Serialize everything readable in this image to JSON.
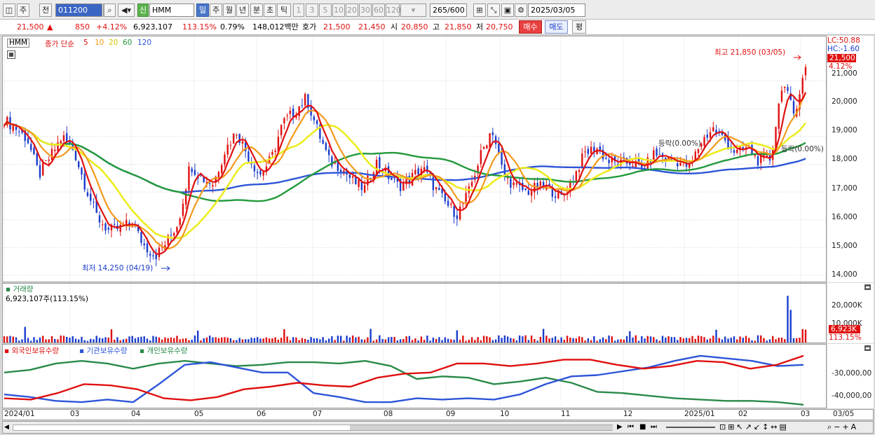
{
  "toolbar": {
    "period_week": "주",
    "period_prev": "전",
    "code": "011200",
    "name_badge": "신",
    "name": "HMM",
    "tabs": [
      "일",
      "주",
      "월",
      "년",
      "분",
      "초",
      "틱"
    ],
    "periods": [
      "1",
      "3",
      "5",
      "10",
      "20",
      "30",
      "60",
      "120"
    ],
    "count": "265",
    "count_total": "/600",
    "date": "2025/03/05"
  },
  "quote": {
    "price": "21,500",
    "change_arrow": "▲",
    "change": "850",
    "change_pct": "+4.12%",
    "volume": "6,923,107",
    "volume_ratio": "113.15%",
    "turnover": "0.79%",
    "amount": "148,012백만",
    "ask_label": "호가",
    "ask": "21,500",
    "bid": "21,450",
    "open_label": "시",
    "open": "20,850",
    "high_label": "고",
    "high": "21,850",
    "low_label": "저",
    "low": "20,750",
    "buy_button": "매수",
    "sell_button": "매도",
    "eval_button": "평"
  },
  "price_panel": {
    "symbol": "HMM",
    "ma_title": "종가 단순",
    "ma_periods": [
      "5",
      "10",
      "20",
      "60",
      "120"
    ],
    "ma_colors": [
      "#e01010",
      "#f39a1c",
      "#ecec20",
      "#239a3c",
      "#2d55d8"
    ],
    "lc": "LC:50.88",
    "hc": "HC:-1.60",
    "price_tag": "21,500",
    "pct_tag": "4.12%",
    "y_ticks": [
      "21,000",
      "20,000",
      "19,000",
      "18,000",
      "17,000",
      "16,000",
      "15,000",
      "14,000"
    ],
    "high_note": "최고 21,850 (03/05)",
    "low_note": "최저 14,250 (04/19)",
    "note_drop": "등락(0.00%)",
    "note_drop2": "등락(0.00%)"
  },
  "volume_panel": {
    "title": "거래량",
    "value": "6,923,107주(113.15%)",
    "y_ticks": [
      "20,000K",
      "10,000K"
    ],
    "tag": "6,923K",
    "tag_pct": "113.15%"
  },
  "holding_panel": {
    "legend": [
      "외국인보유수량",
      "기관보유수량",
      "개인보유수량"
    ],
    "legend_colors": [
      "#e01010",
      "#2d55d8",
      "#2a8a4a"
    ],
    "y_ticks": [
      "-30,000,00",
      "-40,000,00"
    ]
  },
  "x_axis": [
    "2024/01",
    "03",
    "04",
    "05",
    "06",
    "07",
    "08",
    "09",
    "10",
    "11",
    "12",
    "2025/01",
    "02",
    "03",
    "03/05"
  ],
  "chart_data": {
    "type": "candlestick",
    "title": "HMM 011200 일봉",
    "period": "2024/01 - 2025/03/05",
    "ylim": [
      14000,
      21900
    ],
    "high": {
      "value": 21850,
      "date": "03/05"
    },
    "low": {
      "value": 14250,
      "date": "04/19"
    },
    "last_close": 21500,
    "months": [
      "2024/01",
      "03",
      "04",
      "05",
      "06",
      "07",
      "08",
      "09",
      "10",
      "11",
      "12",
      "2025/01",
      "02",
      "03"
    ],
    "close_path": [
      19600,
      19300,
      18900,
      17600,
      18300,
      19000,
      18500,
      17200,
      16100,
      15600,
      15700,
      15900,
      15100,
      14700,
      15200,
      15900,
      18000,
      17500,
      17300,
      18500,
      19200,
      18300,
      17600,
      18200,
      19500,
      19900,
      20400,
      19200,
      18100,
      17900,
      17400,
      17100,
      18100,
      17600,
      17200,
      17500,
      17900,
      17200,
      16600,
      16200,
      17000,
      18300,
      19300,
      17600,
      17200,
      17000,
      17200,
      17100,
      16800,
      17500,
      18400,
      18600,
      18100,
      18000,
      18100,
      17800,
      18400,
      18200,
      18100,
      17900,
      18800,
      19300,
      18900,
      18400,
      18600,
      18100,
      18200,
      21000,
      19800,
      21500
    ]
  }
}
